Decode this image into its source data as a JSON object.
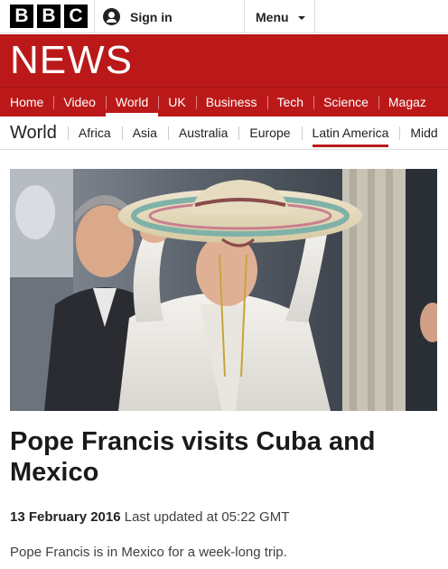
{
  "header": {
    "logo_letters": [
      "B",
      "B",
      "C"
    ],
    "signin_label": "Sign in",
    "signin_icon": "user-icon",
    "menu_label": "Menu",
    "menu_icon": "chevron-down-icon"
  },
  "banner": {
    "wordmark": "NEWS",
    "color": "#bb1919"
  },
  "primary_nav": {
    "items": [
      {
        "label": "Home"
      },
      {
        "label": "Video"
      },
      {
        "label": "World",
        "active": true
      },
      {
        "label": "UK"
      },
      {
        "label": "Business"
      },
      {
        "label": "Tech"
      },
      {
        "label": "Science"
      },
      {
        "label": "Magaz"
      }
    ]
  },
  "secondary_nav": {
    "section_title": "World",
    "items": [
      {
        "label": "Africa"
      },
      {
        "label": "Asia"
      },
      {
        "label": "Australia"
      },
      {
        "label": "Europe"
      },
      {
        "label": "Latin America",
        "active": true
      },
      {
        "label": "Midd"
      }
    ]
  },
  "article": {
    "headline": "Pope Francis visits Cuba and Mexico",
    "date": "13 February 2016",
    "updated": "Last updated at 05:22 GMT",
    "intro": "Pope Francis is in Mexico for a week-long trip."
  }
}
